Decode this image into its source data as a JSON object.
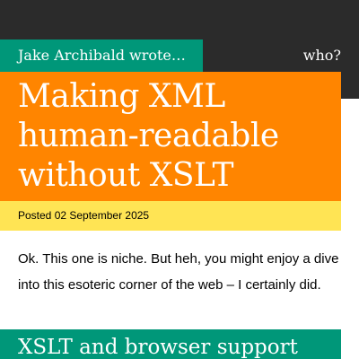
{
  "header": {
    "site_title": "Jake Archibald wrote…",
    "who_link": "who?"
  },
  "post": {
    "title": "Making XML human-readable without XSLT",
    "meta": "Posted 02 September 2025",
    "intro": "Ok. This one is niche. But heh, you might enjoy a dive into this esoteric corner of the web – I certainly did.",
    "section_heading": "XSLT and browser support"
  },
  "colors": {
    "top_bar": "#2b2b2b",
    "brand_green": "#009779",
    "hero_orange": "#ff8500",
    "meta_yellow": "#ffe454"
  }
}
